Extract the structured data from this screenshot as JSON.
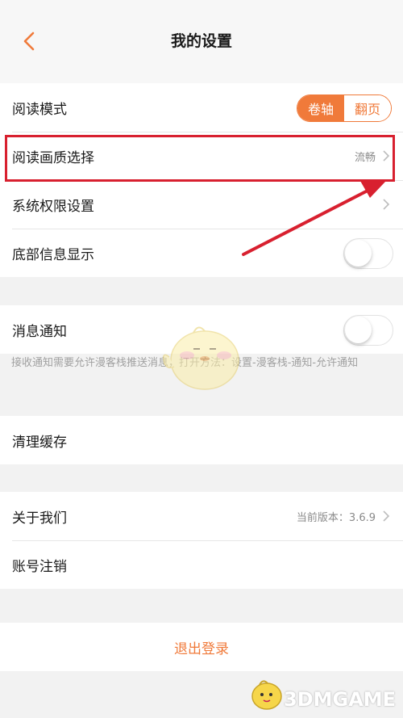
{
  "header": {
    "title": "我的设置",
    "back_icon": "chevron-left-icon"
  },
  "group1": {
    "reading_mode": {
      "label": "阅读模式",
      "options": [
        "卷轴",
        "翻页"
      ],
      "selected": "卷轴"
    },
    "quality": {
      "label": "阅读画质选择",
      "value": "流畅"
    },
    "permissions": {
      "label": "系统权限设置"
    },
    "bottom_info": {
      "label": "底部信息显示",
      "enabled": false
    }
  },
  "group2": {
    "notify": {
      "label": "消息通知",
      "enabled": false
    },
    "hint": "接收通知需要允许漫客栈推送消息，打开方法：设置-漫客栈-通知-允许通知"
  },
  "group3": {
    "clear_cache": {
      "label": "清理缓存"
    }
  },
  "group4": {
    "about": {
      "label": "关于我们",
      "value": "当前版本：3.6.9"
    },
    "account_cancel": {
      "label": "账号注销"
    }
  },
  "logout": {
    "label": "退出登录"
  },
  "watermark": {
    "text": "3DMGAME"
  },
  "colors": {
    "accent": "#f07a3a",
    "highlight": "#d8202f",
    "background": "#f2f2f2"
  }
}
